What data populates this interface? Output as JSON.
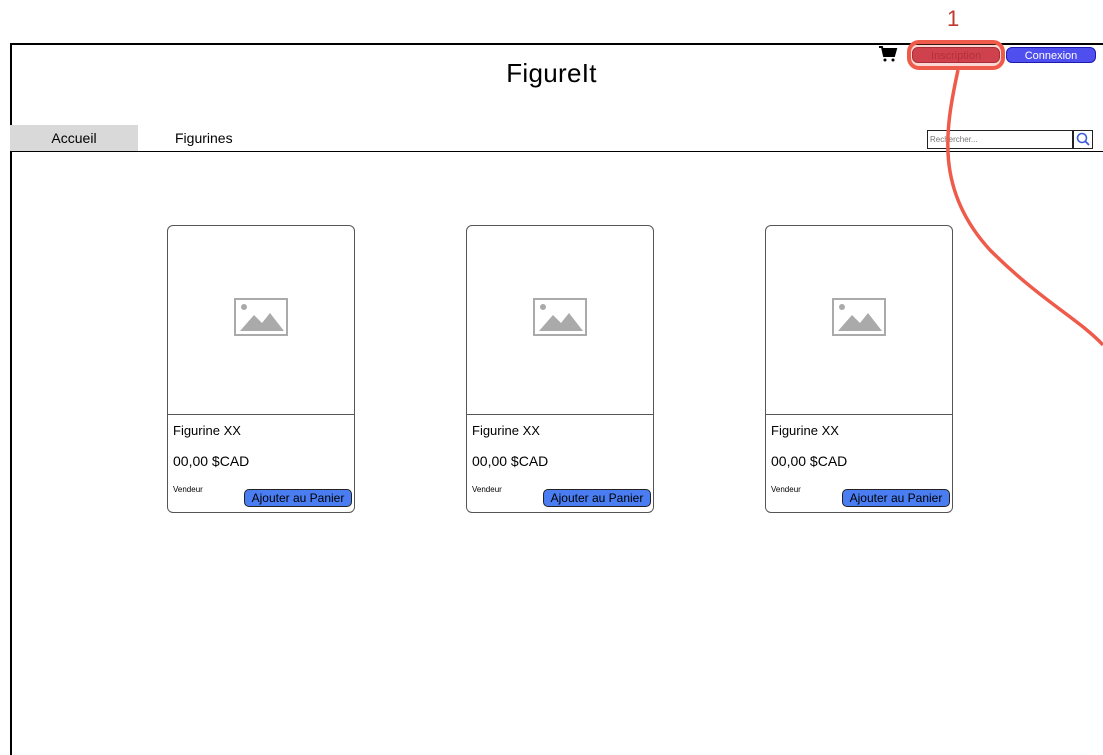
{
  "annotation": {
    "number": "1"
  },
  "header": {
    "title": "FigureIt",
    "inscription_label": "Inscription",
    "connexion_label": "Connexion"
  },
  "nav": {
    "items": [
      {
        "label": "Accueil",
        "active": true
      },
      {
        "label": "Figurines",
        "active": false
      }
    ]
  },
  "search": {
    "placeholder": "Rechercher..."
  },
  "products": [
    {
      "name": "Figurine XX",
      "price": "00,00 $CAD",
      "vendor": "Vendeur",
      "button": "Ajouter au Panier"
    },
    {
      "name": "Figurine XX",
      "price": "00,00 $CAD",
      "vendor": "Vendeur",
      "button": "Ajouter au Panier"
    },
    {
      "name": "Figurine XX",
      "price": "00,00 $CAD",
      "vendor": "Vendeur",
      "button": "Ajouter au Panier"
    }
  ],
  "colors": {
    "annotation": "#ef5b4b",
    "inscription_button": "#c53a4e",
    "connexion_button": "#4f4ff0",
    "add_to_cart_button": "#4a7df2",
    "active_tab": "#d9d9d9"
  },
  "icons": [
    "cart-icon",
    "search-icon",
    "image-placeholder-icon"
  ]
}
